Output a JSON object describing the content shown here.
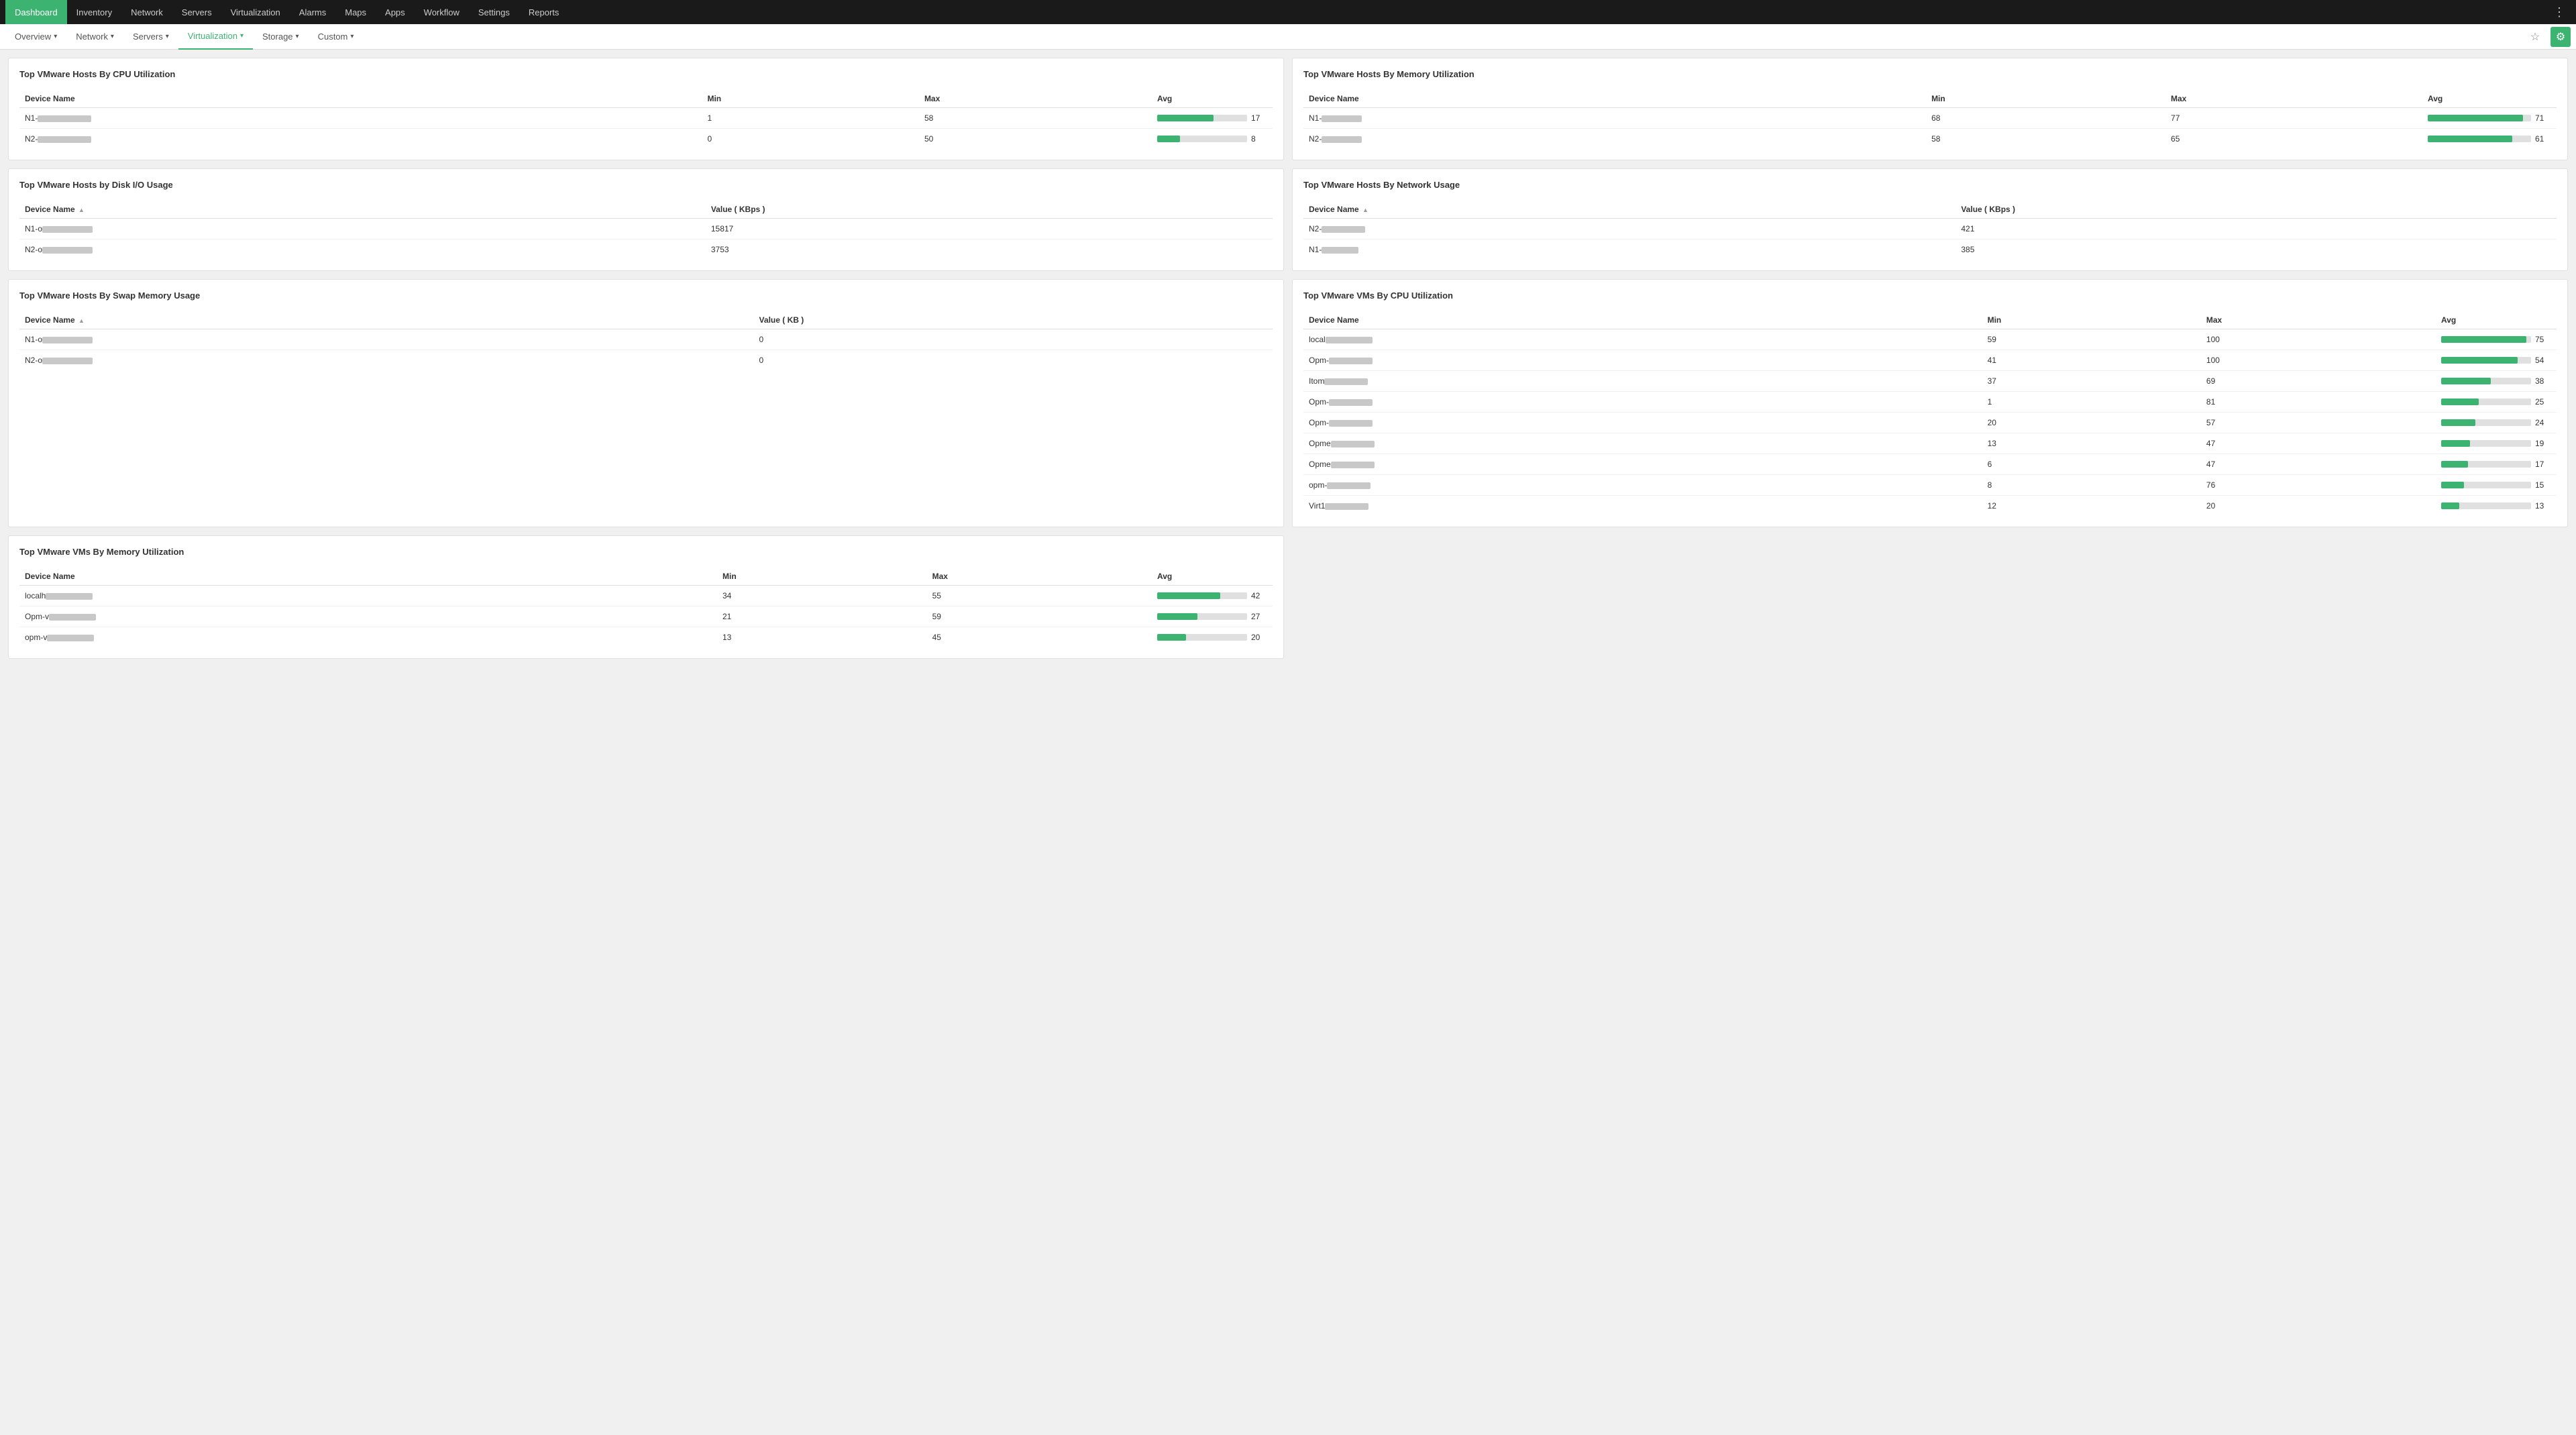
{
  "topNav": {
    "items": [
      {
        "label": "Dashboard",
        "active": true
      },
      {
        "label": "Inventory",
        "active": false
      },
      {
        "label": "Network",
        "active": false
      },
      {
        "label": "Servers",
        "active": false
      },
      {
        "label": "Virtualization",
        "active": false
      },
      {
        "label": "Alarms",
        "active": false
      },
      {
        "label": "Maps",
        "active": false
      },
      {
        "label": "Apps",
        "active": false
      },
      {
        "label": "Workflow",
        "active": false
      },
      {
        "label": "Settings",
        "active": false
      },
      {
        "label": "Reports",
        "active": false
      }
    ]
  },
  "subNav": {
    "items": [
      {
        "label": "Overview",
        "active": false
      },
      {
        "label": "Network",
        "active": false
      },
      {
        "label": "Servers",
        "active": false
      },
      {
        "label": "Virtualization",
        "active": true
      },
      {
        "label": "Storage",
        "active": false
      },
      {
        "label": "Custom",
        "active": false
      }
    ]
  },
  "widgets": {
    "cpuUtilization": {
      "title": "Top VMware Hosts By CPU Utilization",
      "columns": [
        "Device Name",
        "Min",
        "Max",
        "Avg"
      ],
      "rows": [
        {
          "name": "N1-",
          "nameWidth": 80,
          "min": "1",
          "max": "58",
          "avgPct": 63,
          "avgVal": "17"
        },
        {
          "name": "N2-",
          "nameWidth": 80,
          "min": "0",
          "max": "50",
          "avgPct": 28,
          "avgVal": "8"
        }
      ]
    },
    "memoryUtilization": {
      "title": "Top VMware Hosts By Memory Utilization",
      "columns": [
        "Device Name",
        "Min",
        "Max",
        "Avg"
      ],
      "rows": [
        {
          "name": "N1-",
          "nameWidth": 60,
          "min": "68",
          "max": "77",
          "avgPct": 92,
          "avgVal": "71"
        },
        {
          "name": "N2-",
          "nameWidth": 60,
          "min": "58",
          "max": "65",
          "avgPct": 82,
          "avgVal": "61"
        }
      ]
    },
    "diskIO": {
      "title": "Top VMware Hosts by Disk I/O Usage",
      "columns": [
        "Device Name",
        "Value ( KBps )"
      ],
      "rows": [
        {
          "name": "N1-o",
          "nameWidth": 75,
          "value": "15817"
        },
        {
          "name": "N2-o",
          "nameWidth": 75,
          "value": "3753"
        }
      ]
    },
    "networkUsage": {
      "title": "Top VMware Hosts By Network Usage",
      "columns": [
        "Device Name",
        "Value ( KBps )"
      ],
      "rows": [
        {
          "name": "N2-",
          "nameWidth": 65,
          "value": "421"
        },
        {
          "name": "N1-",
          "nameWidth": 55,
          "value": "385"
        }
      ]
    },
    "swapMemory": {
      "title": "Top VMware Hosts By Swap Memory Usage",
      "columns": [
        "Device Name",
        "Value ( KB )"
      ],
      "rows": [
        {
          "name": "N1-o",
          "nameWidth": 75,
          "value": "0"
        },
        {
          "name": "N2-o",
          "nameWidth": 75,
          "value": "0"
        }
      ]
    },
    "vmCpuUtilization": {
      "title": "Top VMware VMs By CPU Utilization",
      "columns": [
        "Device Name",
        "Min",
        "Max",
        "Avg"
      ],
      "rows": [
        {
          "name": "local",
          "nameWidth": 70,
          "min": "59",
          "max": "100",
          "avgPct": 95,
          "avgVal": "75"
        },
        {
          "name": "Opm-",
          "nameWidth": 65,
          "min": "41",
          "max": "100",
          "avgPct": 85,
          "avgVal": "54"
        },
        {
          "name": "Itom",
          "nameWidth": 65,
          "min": "37",
          "max": "69",
          "avgPct": 55,
          "avgVal": "38"
        },
        {
          "name": "Opm-",
          "nameWidth": 65,
          "min": "1",
          "max": "81",
          "avgPct": 42,
          "avgVal": "25"
        },
        {
          "name": "Opm-",
          "nameWidth": 65,
          "min": "20",
          "max": "57",
          "avgPct": 40,
          "avgVal": "24"
        },
        {
          "name": "Opme",
          "nameWidth": 65,
          "min": "13",
          "max": "47",
          "avgPct": 35,
          "avgVal": "19"
        },
        {
          "name": "Opme",
          "nameWidth": 65,
          "min": "6",
          "max": "47",
          "avgPct": 33,
          "avgVal": "17"
        },
        {
          "name": "opm-",
          "nameWidth": 65,
          "min": "8",
          "max": "76",
          "avgPct": 28,
          "avgVal": "15"
        },
        {
          "name": "Virt1",
          "nameWidth": 65,
          "min": "12",
          "max": "20",
          "avgPct": 22,
          "avgVal": "13"
        }
      ]
    },
    "vmMemoryUtilization": {
      "title": "Top VMware VMs By Memory Utilization",
      "columns": [
        "Device Name",
        "Min",
        "Max",
        "Avg"
      ],
      "rows": [
        {
          "name": "localh",
          "nameWidth": 70,
          "min": "34",
          "max": "55",
          "avgPct": 70,
          "avgVal": "42"
        },
        {
          "name": "Opm-v",
          "nameWidth": 70,
          "min": "21",
          "max": "59",
          "avgPct": 42,
          "avgVal": "27"
        },
        {
          "name": "opm-v",
          "nameWidth": 70,
          "min": "13",
          "max": "45",
          "avgPct": 30,
          "avgVal": "20"
        }
      ]
    }
  }
}
